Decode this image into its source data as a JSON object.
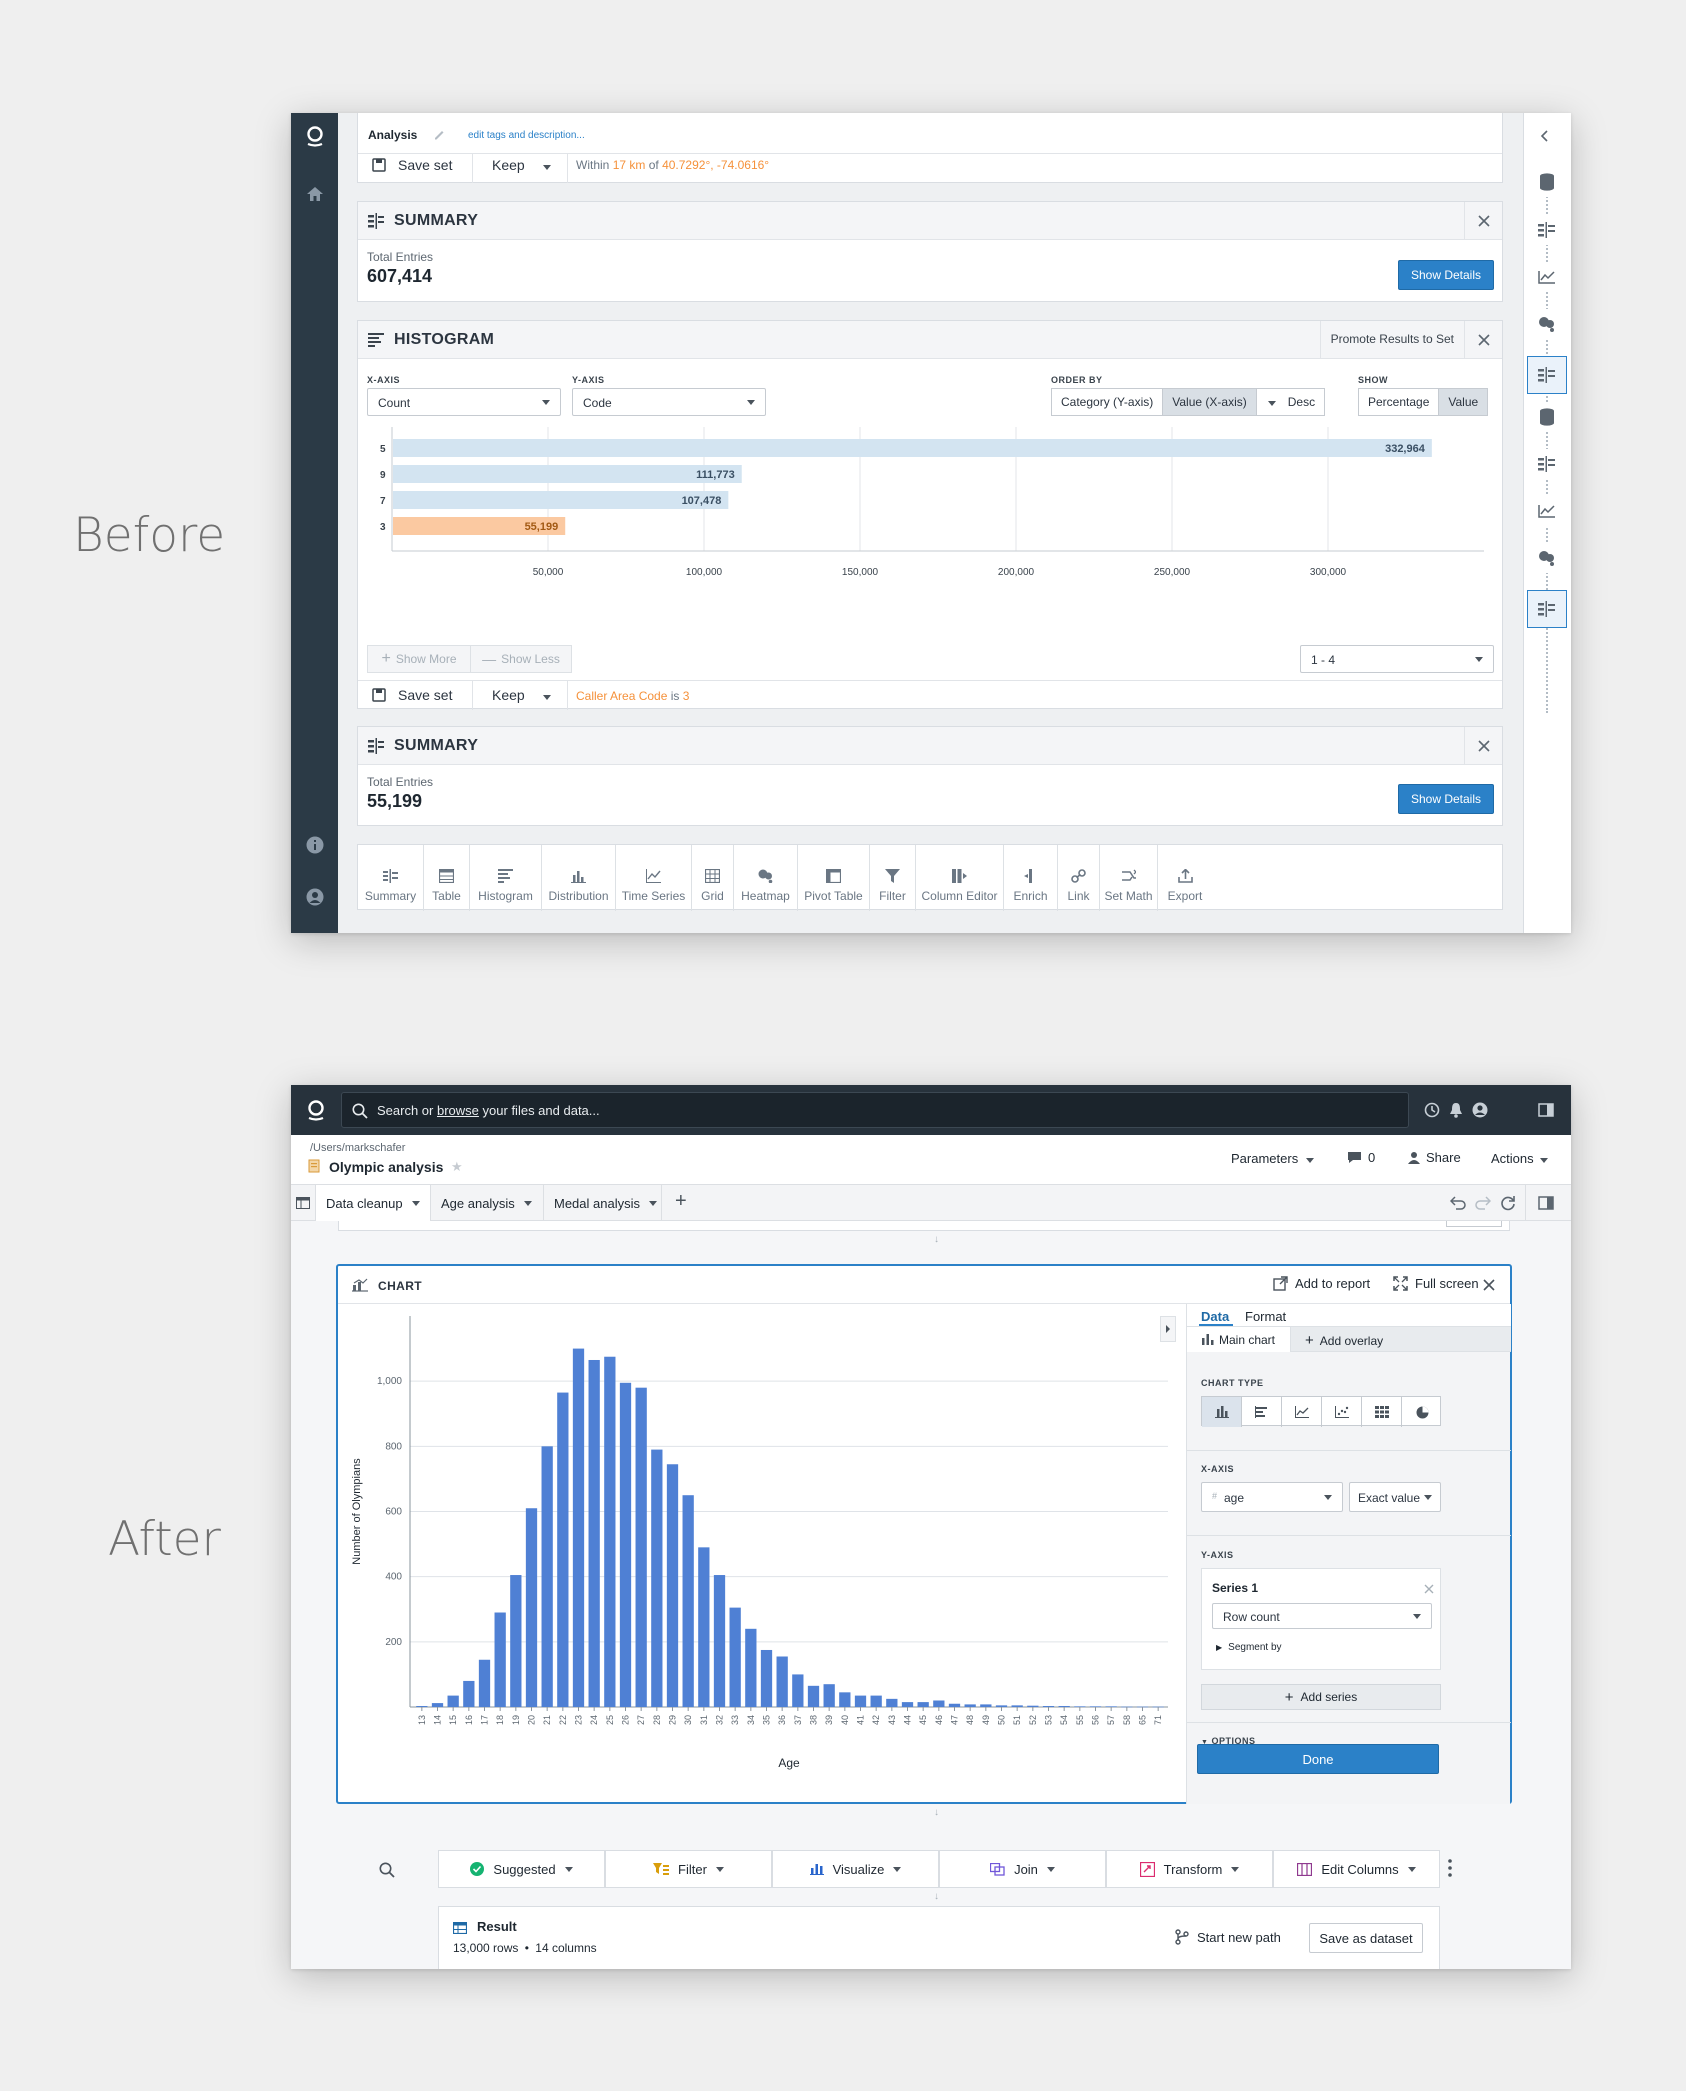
{
  "labels": {
    "before": "Before",
    "after": "After"
  },
  "before": {
    "header": {
      "title": "Analysis",
      "edit_link": "edit tags and description..."
    },
    "top_strip": {
      "save": "Save set",
      "keep": "Keep",
      "within": "Within",
      "km": "17 km",
      "of": "of",
      "coords": "40.7292°, -74.0616°"
    },
    "summary1": {
      "title": "SUMMARY",
      "total_label": "Total Entries",
      "total_value": "607,414",
      "button": "Show Details"
    },
    "histogram": {
      "title": "HISTOGRAM",
      "promote": "Promote Results to Set",
      "xaxis_label": "X-AXIS",
      "xaxis_value": "Count",
      "yaxis_label": "Y-AXIS",
      "yaxis_value": "Code",
      "order_label": "ORDER BY",
      "order_options": [
        "Category (Y-axis)",
        "Value (X-axis)"
      ],
      "order_dir": "Desc",
      "show_label": "SHOW",
      "show_options": [
        "Percentage",
        "Value"
      ],
      "show_more": "Show More",
      "show_less": "Show Less",
      "range": "1 - 4",
      "save": "Save set",
      "keep": "Keep",
      "filter_field": "Caller Area Code",
      "filter_is": "is",
      "filter_value": "3"
    },
    "summary2": {
      "title": "SUMMARY",
      "total_label": "Total Entries",
      "total_value": "55,199",
      "button": "Show Details"
    },
    "toolbar": [
      "Summary",
      "Table",
      "Histogram",
      "Distribution",
      "Time Series",
      "Grid",
      "Heatmap",
      "Pivot Table",
      "Filter",
      "Column Editor",
      "Enrich",
      "Link",
      "Set Math",
      "Export"
    ]
  },
  "after": {
    "search_placeholder_pre": "Search or",
    "search_link": "browse",
    "search_placeholder_post": "your files and data...",
    "breadcrumb": "/Users/markschafer",
    "doc_title": "Olympic analysis",
    "header_actions": {
      "parameters": "Parameters",
      "comments": "0",
      "share": "Share",
      "actions": "Actions"
    },
    "tabs": [
      "Data cleanup",
      "Age analysis",
      "Medal analysis"
    ],
    "chart_card": {
      "title": "CHART",
      "add_to_report": "Add to report",
      "full_screen": "Full screen"
    },
    "panel": {
      "tabs": [
        "Data",
        "Format"
      ],
      "main_chart": "Main chart",
      "add_overlay": "Add overlay",
      "chart_type_label": "CHART TYPE",
      "xaxis_label": "X-AXIS",
      "xaxis_field": "age",
      "xaxis_mode": "Exact value",
      "yaxis_label": "Y-AXIS",
      "series_name": "Series 1",
      "series_metric": "Row count",
      "segment_by": "Segment by",
      "add_series": "Add series",
      "options_label": "OPTIONS",
      "done": "Done"
    },
    "bottom_bar": [
      "Suggested",
      "Filter",
      "Visualize",
      "Join",
      "Transform",
      "Edit Columns"
    ],
    "result": {
      "title": "Result",
      "rows": "13,000 rows",
      "sep": "•",
      "cols": "14 columns",
      "start_path": "Start new path",
      "save_dataset": "Save as dataset"
    }
  },
  "chart_data": [
    {
      "type": "bar",
      "orientation": "horizontal",
      "categories": [
        "5",
        "9",
        "7",
        "3"
      ],
      "values": [
        332964,
        111773,
        107478,
        55199
      ],
      "value_labels": [
        "332,964",
        "111,773",
        "107,478",
        "55,199"
      ],
      "highlight": "3",
      "xticks": [
        "50,000",
        "100,000",
        "150,000",
        "200,000",
        "250,000",
        "300,000"
      ],
      "xlim": [
        0,
        350000
      ],
      "colors": {
        "default": "#d3e4f1",
        "highlight": "#fbc9a1"
      }
    },
    {
      "type": "bar",
      "xlabel": "Age",
      "ylabel": "Number of Olympians",
      "categories": [
        "13",
        "14",
        "15",
        "16",
        "17",
        "18",
        "19",
        "20",
        "21",
        "22",
        "23",
        "24",
        "25",
        "26",
        "27",
        "28",
        "29",
        "30",
        "31",
        "32",
        "33",
        "34",
        "35",
        "36",
        "37",
        "38",
        "39",
        "40",
        "41",
        "42",
        "43",
        "44",
        "45",
        "46",
        "47",
        "48",
        "49",
        "50",
        "51",
        "52",
        "53",
        "54",
        "55",
        "56",
        "57",
        "58",
        "65",
        "71"
      ],
      "values": [
        3,
        12,
        35,
        80,
        145,
        290,
        405,
        610,
        800,
        965,
        1100,
        1065,
        1075,
        995,
        980,
        790,
        745,
        650,
        490,
        405,
        305,
        240,
        175,
        155,
        100,
        65,
        70,
        45,
        35,
        35,
        25,
        15,
        15,
        20,
        10,
        8,
        8,
        5,
        5,
        4,
        3,
        3,
        2,
        2,
        2,
        1,
        1,
        1
      ],
      "yticks": [
        "200",
        "400",
        "600",
        "800",
        "1,000"
      ],
      "ylim": [
        0,
        1200
      ],
      "grid": true,
      "colors": {
        "bar": "#4f80d4"
      }
    }
  ]
}
